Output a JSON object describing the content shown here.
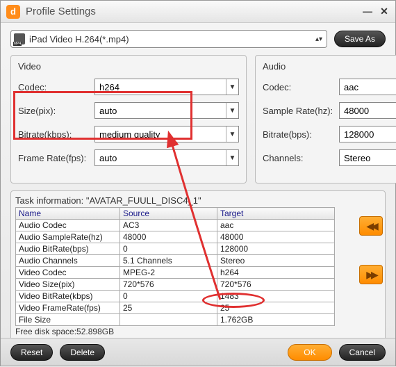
{
  "title": "Profile Settings",
  "profile": {
    "label": "iPad Video H.264(*.mp4)"
  },
  "save_as": "Save As",
  "video": {
    "heading": "Video",
    "codec_label": "Codec:",
    "codec": "h264",
    "size_label": "Size(pix):",
    "size": "auto",
    "bitrate_label": "Bitrate(kbps):",
    "bitrate": "medium quality",
    "framerate_label": "Frame Rate(fps):",
    "framerate": "auto"
  },
  "audio": {
    "heading": "Audio",
    "codec_label": "Codec:",
    "codec": "aac",
    "samplerate_label": "Sample Rate(hz):",
    "samplerate": "48000",
    "bitrate_label": "Bitrate(bps):",
    "bitrate": "128000",
    "channels_label": "Channels:",
    "channels": "Stereo"
  },
  "task": {
    "title_prefix": "Task information: \"",
    "title_name": "AVATAR_FUULL_DISC4_1",
    "title_suffix": "\"",
    "headers": {
      "name": "Name",
      "source": "Source",
      "target": "Target"
    },
    "rows": [
      {
        "name": "Audio Codec",
        "source": "AC3",
        "target": "aac"
      },
      {
        "name": "Audio SampleRate(hz)",
        "source": "48000",
        "target": "48000"
      },
      {
        "name": "Audio BitRate(bps)",
        "source": "0",
        "target": "128000"
      },
      {
        "name": "Audio Channels",
        "source": "5.1 Channels",
        "target": "Stereo"
      },
      {
        "name": "Video Codec",
        "source": "MPEG-2",
        "target": "h264"
      },
      {
        "name": "Video Size(pix)",
        "source": "720*576",
        "target": "720*576"
      },
      {
        "name": "Video BitRate(kbps)",
        "source": "0",
        "target": "1483"
      },
      {
        "name": "Video FrameRate(fps)",
        "source": "25",
        "target": "25"
      },
      {
        "name": "File Size",
        "source": "",
        "target": "1.762GB"
      }
    ],
    "freespace": "Free disk space:52.898GB"
  },
  "buttons": {
    "reset": "Reset",
    "delete": "Delete",
    "ok": "OK",
    "cancel": "Cancel"
  }
}
